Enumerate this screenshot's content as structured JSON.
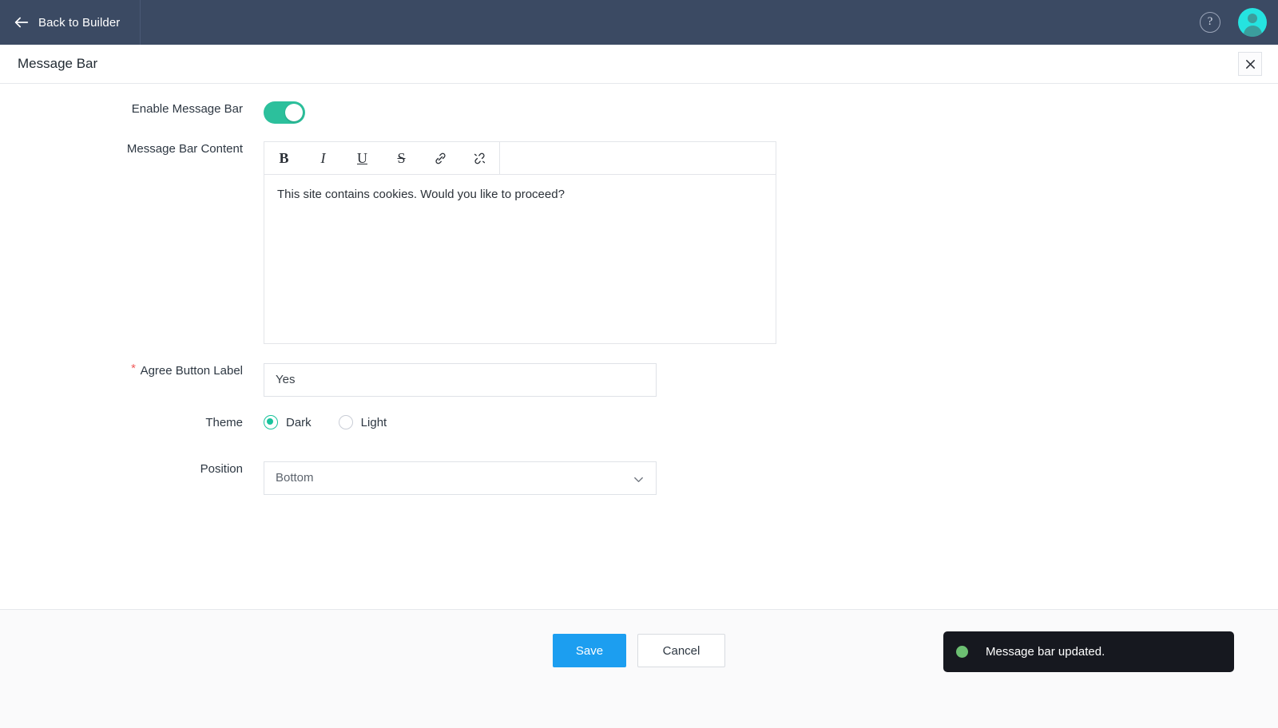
{
  "topnav": {
    "back_label": "Back to Builder",
    "back_icon": "arrow-left-icon",
    "help_icon": "?",
    "avatar_icon": "user-avatar-icon",
    "background_color": "#3b4a63"
  },
  "titlebar": {
    "title": "Message Bar",
    "close_icon": "close-icon"
  },
  "form": {
    "enable": {
      "label": "Enable Message Bar",
      "state": "on",
      "toggle_color": "#2cc09c"
    },
    "content": {
      "label": "Message Bar Content",
      "toolbar": [
        {
          "name": "bold-button",
          "glyph": "B"
        },
        {
          "name": "italic-button",
          "glyph": "I"
        },
        {
          "name": "underline-button",
          "glyph": "U"
        },
        {
          "name": "strikethrough-button",
          "glyph": "S"
        },
        {
          "name": "link-button",
          "glyph": "link-icon"
        },
        {
          "name": "unlink-button",
          "glyph": "unlink-icon"
        }
      ],
      "value": "This site contains cookies. Would you like to proceed?"
    },
    "agree_button": {
      "label": "Agree Button Label",
      "required_marker": "*",
      "value": "Yes"
    },
    "theme": {
      "label": "Theme",
      "options": [
        {
          "label": "Dark",
          "selected": true
        },
        {
          "label": "Light",
          "selected": false
        }
      ],
      "accent_color": "#19c39c"
    },
    "position": {
      "label": "Position",
      "value": "Bottom",
      "chevron_icon": "chevron-down-icon"
    }
  },
  "footer": {
    "save_label": "Save",
    "cancel_label": "Cancel",
    "save_color": "#1c9ef0"
  },
  "toast": {
    "message": "Message bar updated.",
    "status_color": "#6cbf72",
    "background_color": "#16181f"
  }
}
